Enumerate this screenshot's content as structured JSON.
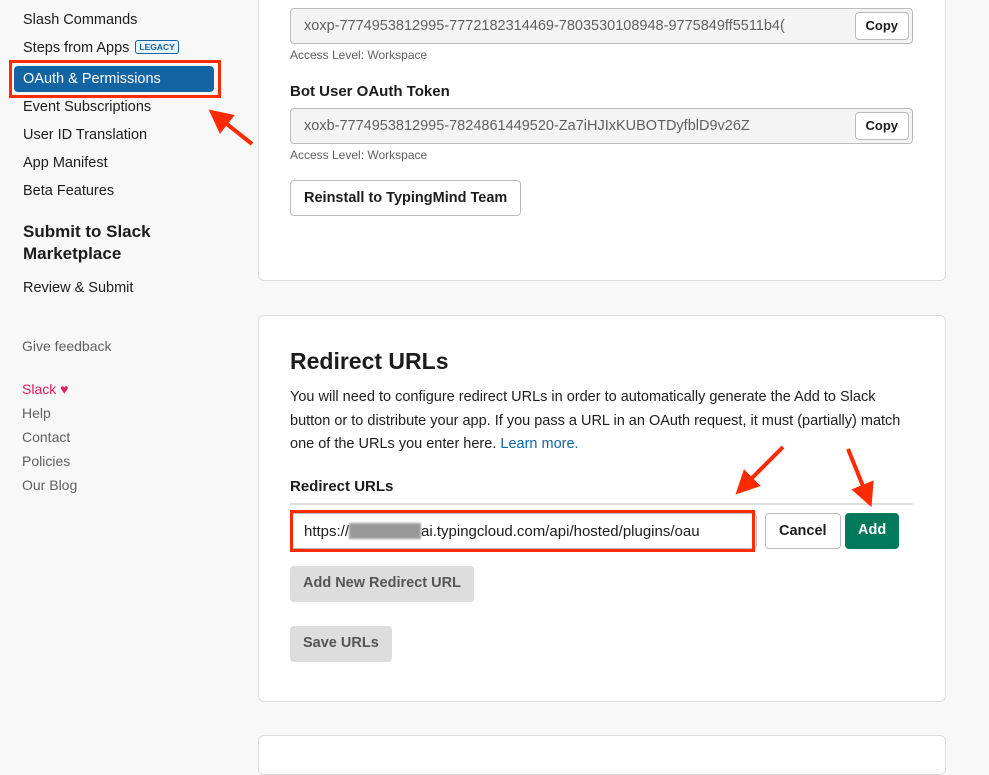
{
  "sidebar": {
    "items": [
      "Slash Commands",
      "Steps from Apps",
      "OAuth & Permissions",
      "Event Subscriptions",
      "User ID Translation",
      "App Manifest",
      "Beta Features"
    ],
    "legacy_badge": "LEGACY",
    "submit_section_title": "Submit to Slack Marketplace",
    "review_submit": "Review & Submit",
    "give_feedback": "Give feedback",
    "footer": {
      "slack": "Slack",
      "heart": "♥",
      "help": "Help",
      "contact": "Contact",
      "policies": "Policies",
      "blog": "Our Blog"
    }
  },
  "tokens": {
    "user_token": "xoxp-7774953812995-7772182314469-7803530108948-9775849ff5511b4(",
    "user_access": "Access Level: Workspace",
    "bot_label": "Bot User OAuth Token",
    "bot_token": "xoxb-7774953812995-7824861449520-Za7iHJIxKUBOTDyfblD9v26Z",
    "bot_access": "Access Level: Workspace",
    "copy_label": "Copy",
    "reinstall_label": "Reinstall to TypingMind Team"
  },
  "redirect": {
    "title": "Redirect URLs",
    "description": "You will need to configure redirect URLs in order to automatically generate the Add to Slack button or to distribute your app. If you pass a URL in an OAuth request, it must (partially) match one of the URLs you enter here.",
    "learn_more": "Learn more.",
    "field_label": "Redirect URLs",
    "url_prefix": "https://",
    "url_suffix": "ai.typingcloud.com/api/hosted/plugins/oau",
    "cancel_label": "Cancel",
    "add_label": "Add",
    "add_new_label": "Add New Redirect URL",
    "save_label": "Save URLs"
  },
  "colors": {
    "accent": "#1264a3",
    "add_green": "#007a5a",
    "highlight": "#ff2a00",
    "slack_pink": "#e01e5a"
  }
}
